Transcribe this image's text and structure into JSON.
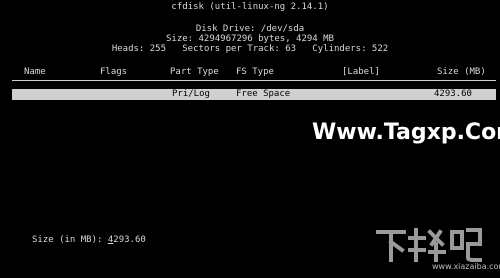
{
  "app": {
    "title": "cfdisk (util-linux-ng 2.14.1)"
  },
  "disk": {
    "drive_line": "Disk Drive: /dev/sda",
    "size_line": "Size: 4294967296 bytes, 4294 MB",
    "geometry_line": "Heads: 255   Sectors per Track: 63   Cylinders: 522"
  },
  "table": {
    "headers": {
      "name": "Name",
      "flags": "Flags",
      "part_type": "Part Type",
      "fs_type": "FS Type",
      "label": "[Label]",
      "size": "Size (MB)"
    },
    "rows": [
      {
        "name": "",
        "flags": "",
        "part_type": "Pri/Log",
        "fs_type": "Free Space",
        "label": "",
        "size": "4293.60"
      }
    ]
  },
  "prompt": {
    "label": "Size (in MB): ",
    "value_first_char": "4",
    "value_rest": "293.60"
  },
  "watermark": {
    "text": "Www.Tagxp.Com"
  },
  "logo": {
    "glyphs": "下载吧",
    "url": "www.xiazaiba.com"
  }
}
